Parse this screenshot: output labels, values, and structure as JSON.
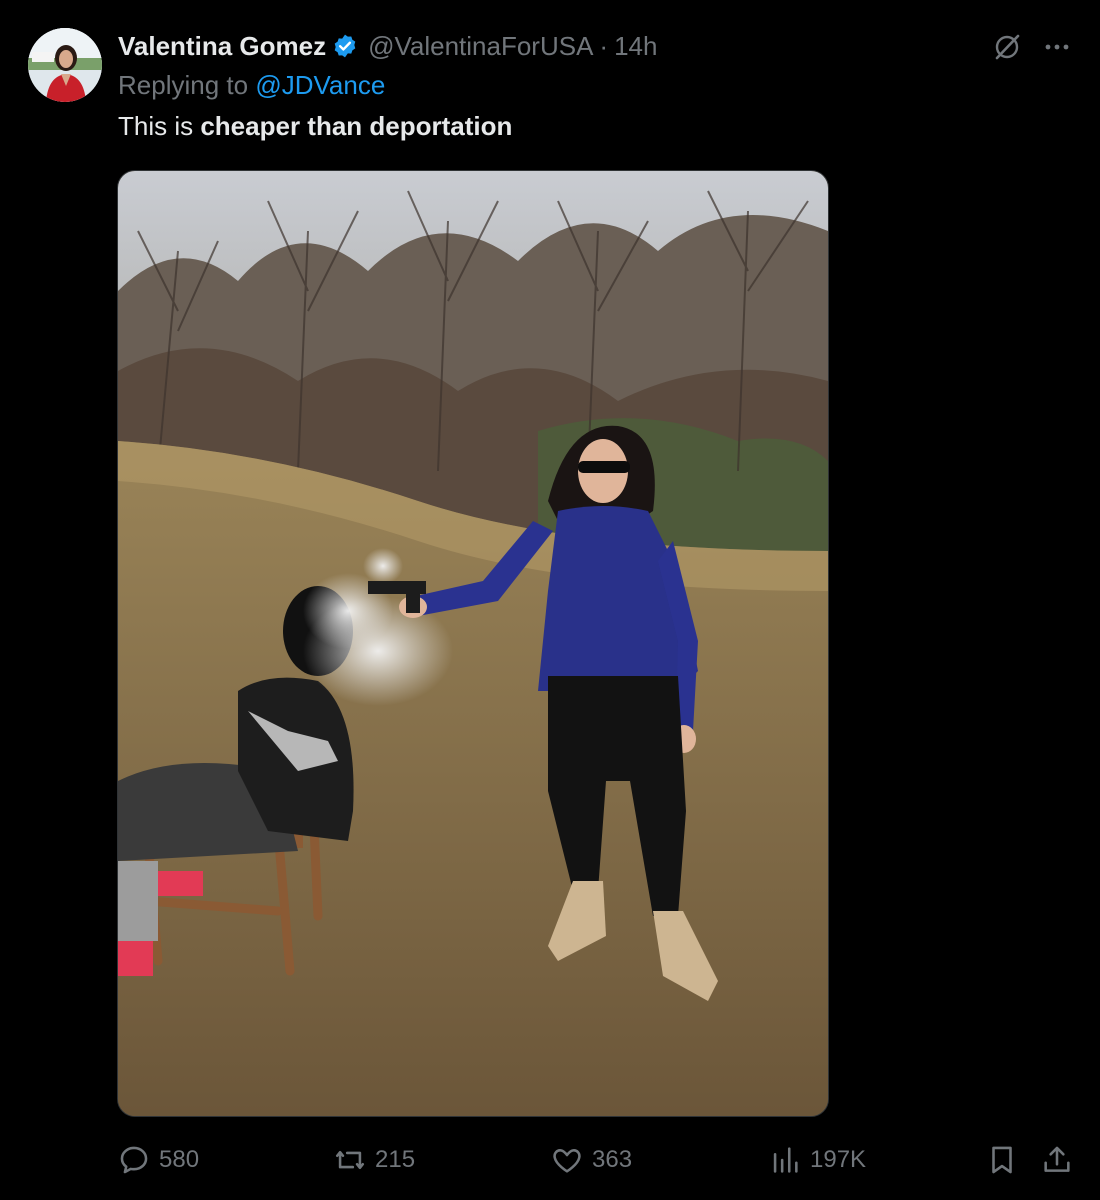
{
  "author": {
    "display_name": "Valentina Gomez",
    "handle": "@ValentinaForUSA",
    "time": "14h",
    "verified_color": "#1d9bf0"
  },
  "reply": {
    "prefix": "Replying to",
    "mention": "@JDVance"
  },
  "tweet": {
    "text_plain": "This is ",
    "text_bold": "cheaper than deportation"
  },
  "separator": "·",
  "metrics": {
    "replies": "580",
    "reposts": "215",
    "likes": "363",
    "views": "197K"
  },
  "icons": {
    "grok": "grok-icon",
    "more": "more-icon",
    "reply": "reply-icon",
    "repost": "repost-icon",
    "like": "heart-icon",
    "views": "views-icon",
    "bookmark": "bookmark-icon",
    "share": "share-icon"
  },
  "colors": {
    "background": "#000000",
    "text": "#e7e9ea",
    "secondary": "#71767b",
    "accent": "#1d9bf0"
  }
}
